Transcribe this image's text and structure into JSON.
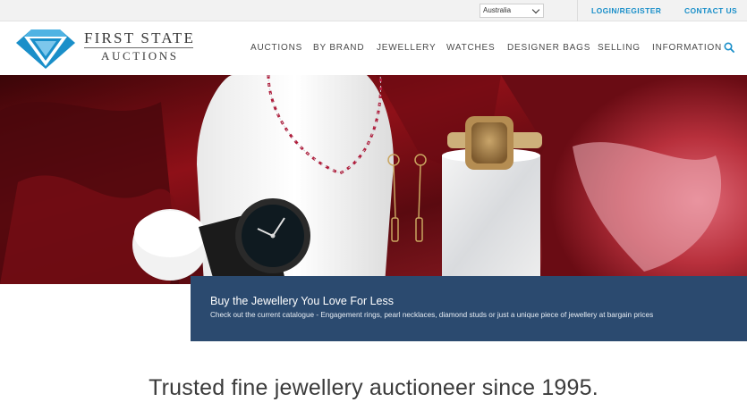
{
  "topbar": {
    "country_selected": "Australia",
    "login_label": "LOGIN/REGISTER",
    "contact_label": "CONTACT US"
  },
  "logo": {
    "line1": "FIRST STATE",
    "line2": "AUCTIONS",
    "accent_color": "#1a8fc9"
  },
  "nav": {
    "items": [
      {
        "label": "AUCTIONS"
      },
      {
        "label": "BY BRAND"
      },
      {
        "label": "JEWELLERY"
      },
      {
        "label": "WATCHES"
      },
      {
        "label": "DESIGNER BAGS"
      },
      {
        "label": "SELLING"
      },
      {
        "label": "INFORMATION"
      }
    ],
    "search_icon": "search-icon"
  },
  "hero": {
    "caption_title": "Buy the Jewellery You Love For Less",
    "caption_text": "Check out the current catalogue - Engagement rings, pearl necklaces, diamond studs or just a unique piece of jewellery at bargain prices",
    "caption_bg": "#2b4a6f"
  },
  "tagline": "Trusted fine jewellery auctioneer since 1995."
}
